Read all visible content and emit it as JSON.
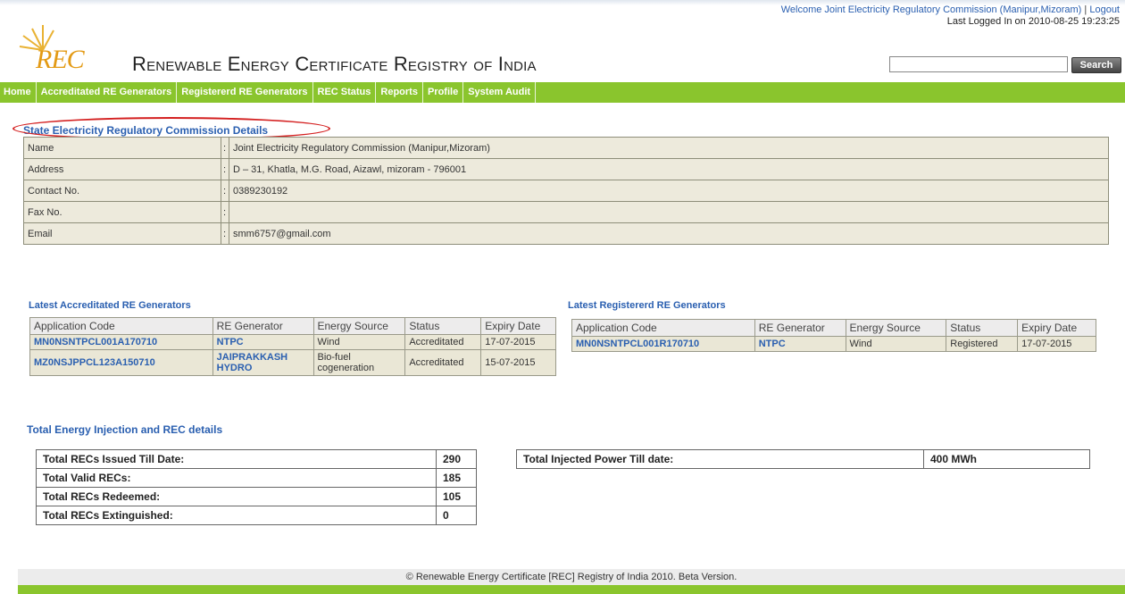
{
  "header": {
    "welcome_text": "Welcome Joint Electricity Regulatory Commission (Manipur,Mizoram)",
    "separator": "|",
    "logout_label": "Logout",
    "last_logged": "Last Logged In on 2010-08-25 19:23:25",
    "logo_text": "REC",
    "site_title": "Renewable Energy Certificate Registry of India",
    "search_placeholder": "",
    "search_label": "Search"
  },
  "nav": {
    "items": [
      {
        "label": "Home"
      },
      {
        "label": "Accreditated RE Generators"
      },
      {
        "label": "Registererd RE Generators"
      },
      {
        "label": "REC Status"
      },
      {
        "label": "Reports"
      },
      {
        "label": "Profile"
      },
      {
        "label": "System Audit"
      }
    ]
  },
  "details": {
    "title": "State Electricity Regulatory Commission Details",
    "rows": [
      {
        "label": "Name",
        "value": "Joint Electricity Regulatory Commission (Manipur,Mizoram)"
      },
      {
        "label": "Address",
        "value": "D – 31, Khatla, M.G. Road, Aizawl, mizoram - 796001"
      },
      {
        "label": "Contact No.",
        "value": "0389230192"
      },
      {
        "label": "Fax No.",
        "value": ""
      },
      {
        "label": "Email",
        "value": "smm6757@gmail.com"
      }
    ]
  },
  "accredited": {
    "title": "Latest Accreditated RE Generators",
    "headers": [
      "Application Code",
      "RE Generator",
      "Energy Source",
      "Status",
      "Expiry Date"
    ],
    "rows": [
      [
        "MN0NSNTPCL001A170710",
        "NTPC",
        "Wind",
        "Accreditated",
        "17-07-2015"
      ],
      [
        "MZ0NSJPPCL123A150710",
        "JAIPRAKKASH HYDRO",
        "Bio-fuel cogeneration",
        "Accreditated",
        "15-07-2015"
      ]
    ]
  },
  "registered": {
    "title": "Latest Registererd RE Generators",
    "headers": [
      "Application Code",
      "RE Generator",
      "Energy Source",
      "Status",
      "Expiry Date"
    ],
    "rows": [
      [
        "MN0NSNTPCL001R170710",
        "NTPC",
        "Wind",
        "Registered",
        "17-07-2015"
      ]
    ]
  },
  "totals": {
    "title": "Total Energy Injection and REC details",
    "rec_rows": [
      {
        "label": "Total RECs Issued Till Date:",
        "value": "290"
      },
      {
        "label": "Total Valid RECs:",
        "value": "185"
      },
      {
        "label": "Total RECs Redeemed:",
        "value": "105"
      },
      {
        "label": "Total RECs Extinguished:",
        "value": "0"
      }
    ],
    "power_label": "Total Injected Power Till date:",
    "power_value": "400 MWh"
  },
  "footer": {
    "text": "© Renewable Energy Certificate [REC] Registry of India 2010. Beta Version."
  },
  "colors": {
    "nav_green": "#8ac52d",
    "link_blue": "#2a5fb0",
    "highlight_red": "#d42020",
    "logo_orange": "#e39a14"
  }
}
